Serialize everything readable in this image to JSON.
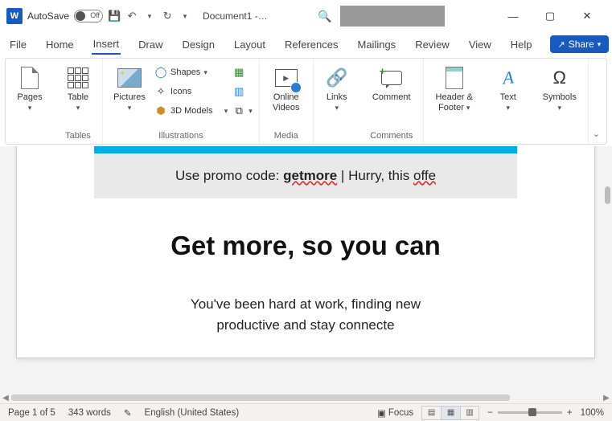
{
  "titlebar": {
    "autosave_label": "AutoSave",
    "autosave_state": "Off",
    "doc_title": "Document1  -…"
  },
  "win": {
    "min": "—",
    "max": "▢",
    "close": "✕"
  },
  "tabs": {
    "file": "File",
    "home": "Home",
    "insert": "Insert",
    "draw": "Draw",
    "design": "Design",
    "layout": "Layout",
    "references": "References",
    "mailings": "Mailings",
    "review": "Review",
    "view": "View",
    "help": "Help"
  },
  "share": {
    "label": "Share"
  },
  "ribbon": {
    "pages": {
      "label": "Pages"
    },
    "tables": {
      "btn": "Table",
      "group": "Tables"
    },
    "illus": {
      "pictures": "Pictures",
      "shapes": "Shapes",
      "icons": "Icons",
      "models": "3D Models",
      "group": "Illustrations"
    },
    "media": {
      "btn_l1": "Online",
      "btn_l2": "Videos",
      "group": "Media"
    },
    "links": {
      "btn": "Links"
    },
    "comments": {
      "btn": "Comment",
      "group": "Comments"
    },
    "hf": {
      "l1": "Header &",
      "l2": "Footer"
    },
    "text": {
      "btn": "Text"
    },
    "symbols": {
      "btn": "Symbols"
    }
  },
  "doc": {
    "promo_pre": "Use promo code: ",
    "promo_code": "getmore",
    "promo_mid": " | Hurry, this ",
    "promo_cut": "offe",
    "headline": "Get more, so you can",
    "body1": "You've been hard at work, finding new",
    "body2": "productive and stay connecte"
  },
  "status": {
    "page": "Page 1 of 5",
    "words": "343 words",
    "lang": "English (United States)",
    "focus": "Focus",
    "zoom_minus": "−",
    "zoom_plus": "+",
    "zoom_pct": "100%"
  }
}
